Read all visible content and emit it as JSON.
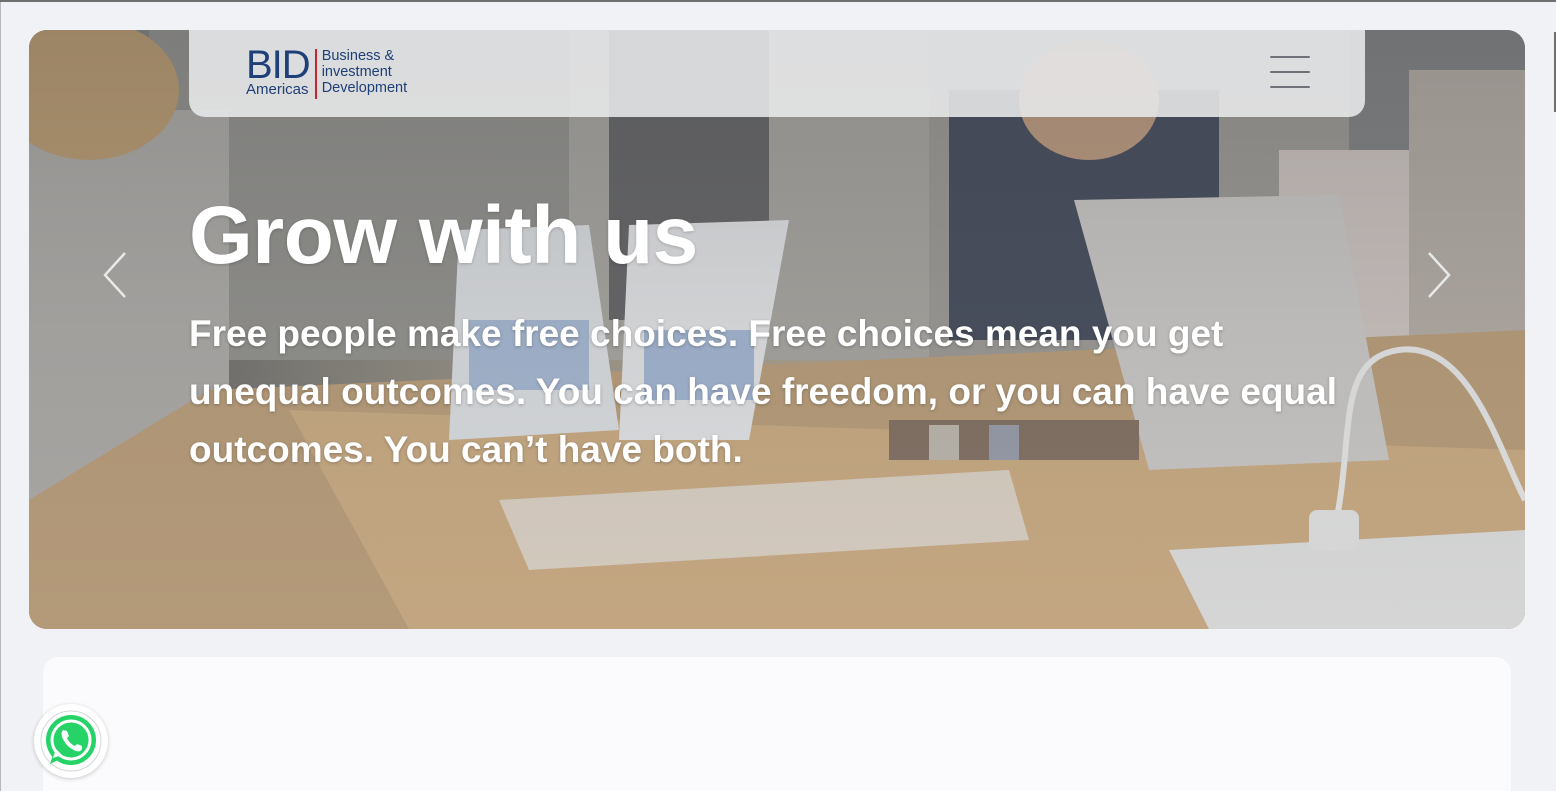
{
  "logo": {
    "bid": "BID",
    "americas": "Americas",
    "line1": "Business &",
    "line2": "investment",
    "line3": "Development",
    "primary_color": "#1f3f78",
    "accent_color": "#c2272d"
  },
  "nav": {
    "menu_icon": "hamburger-icon"
  },
  "hero": {
    "title": "Grow with us",
    "text": "Free people make free choices. Free choices mean you get unequal outcomes. You can have freedom, or you can have equal outcomes. You can’t have both.",
    "prev_icon": "chevron-left-icon",
    "next_icon": "chevron-right-icon"
  },
  "floating": {
    "whatsapp_icon": "whatsapp-icon",
    "whatsapp_color": "#25d366"
  }
}
